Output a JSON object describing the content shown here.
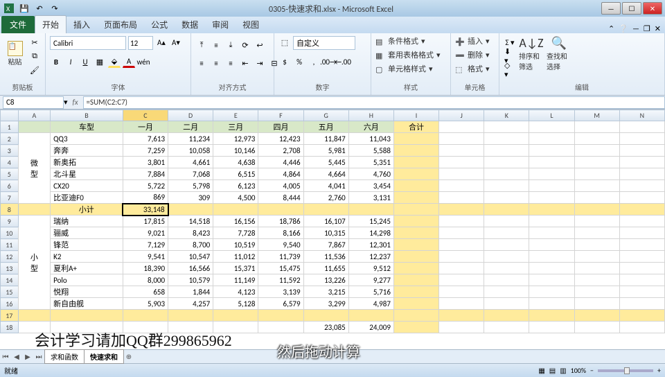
{
  "app": {
    "title": "0305-快速求和.xlsx - Microsoft Excel"
  },
  "tabs": {
    "file": "文件",
    "home": "开始",
    "insert": "插入",
    "layout": "页面布局",
    "formulas": "公式",
    "data": "数据",
    "review": "审阅",
    "view": "视图"
  },
  "ribbon": {
    "clipboard": {
      "label": "剪贴板",
      "paste": "粘贴"
    },
    "font": {
      "label": "字体",
      "name": "Calibri",
      "size": "12"
    },
    "alignment": {
      "label": "对齐方式"
    },
    "number": {
      "label": "数字",
      "format": "自定义"
    },
    "styles": {
      "label": "样式",
      "cond": "条件格式",
      "tablefmt": "套用表格格式",
      "cellfmt": "单元格样式"
    },
    "cells": {
      "label": "单元格",
      "insert": "插入",
      "delete": "删除",
      "format": "格式"
    },
    "editing": {
      "label": "编辑",
      "sortfilter": "排序和筛选",
      "findselect": "查找和选择"
    }
  },
  "nameBox": "C8",
  "formula": "=SUM(C2:C7)",
  "columns": [
    "A",
    "B",
    "C",
    "D",
    "E",
    "F",
    "G",
    "H",
    "I",
    "J",
    "K",
    "L",
    "M",
    "N"
  ],
  "header": {
    "model": "车型",
    "m1": "一月",
    "m2": "二月",
    "m3": "三月",
    "m4": "四月",
    "m5": "五月",
    "m6": "六月",
    "total": "合计"
  },
  "groupA": "微型",
  "groupB": "小型",
  "subtotal": "小计",
  "rows": [
    {
      "name": "QQ3",
      "v": [
        "7,613",
        "11,234",
        "12,973",
        "12,423",
        "11,847",
        "11,043"
      ]
    },
    {
      "name": "奔奔",
      "v": [
        "7,259",
        "10,058",
        "10,146",
        "2,708",
        "5,981",
        "5,588"
      ]
    },
    {
      "name": "新奥拓",
      "v": [
        "3,801",
        "4,661",
        "4,638",
        "4,446",
        "5,445",
        "5,351"
      ]
    },
    {
      "name": "北斗星",
      "v": [
        "7,884",
        "7,068",
        "6,515",
        "4,864",
        "4,664",
        "4,760"
      ]
    },
    {
      "name": "CX20",
      "v": [
        "5,722",
        "5,798",
        "6,123",
        "4,005",
        "4,041",
        "3,454"
      ]
    },
    {
      "name": "比亚迪F0",
      "v": [
        "869",
        "309",
        "4,500",
        "8,444",
        "2,760",
        "3,131"
      ]
    }
  ],
  "subtotalA": "33,148",
  "rowsB": [
    {
      "name": "瑞纳",
      "v": [
        "17,815",
        "14,518",
        "16,156",
        "18,786",
        "16,107",
        "15,245"
      ]
    },
    {
      "name": "骊威",
      "v": [
        "9,021",
        "8,423",
        "7,728",
        "8,166",
        "10,315",
        "14,298"
      ]
    },
    {
      "name": "锋范",
      "v": [
        "7,129",
        "8,700",
        "10,519",
        "9,540",
        "7,867",
        "12,301"
      ]
    },
    {
      "name": "K2",
      "v": [
        "9,541",
        "10,547",
        "11,012",
        "11,739",
        "11,536",
        "12,237"
      ]
    },
    {
      "name": "夏利A+",
      "v": [
        "18,390",
        "16,566",
        "15,371",
        "15,475",
        "11,655",
        "9,512"
      ]
    },
    {
      "name": "Polo",
      "v": [
        "8,000",
        "10,579",
        "11,149",
        "11,592",
        "13,226",
        "9,277"
      ]
    },
    {
      "name": "悦翔",
      "v": [
        "658",
        "1,844",
        "4,123",
        "3,139",
        "3,215",
        "5,716"
      ]
    },
    {
      "name": "新自由舰",
      "v": [
        "5,903",
        "4,257",
        "5,128",
        "6,579",
        "3,299",
        "4,987"
      ]
    }
  ],
  "row18": {
    "g": "23,085",
    "h": "24,009"
  },
  "sheetTabs": {
    "t1": "求和函数",
    "t2": "快速求和"
  },
  "status": {
    "ready": "就绪",
    "zoom": "100%"
  },
  "overlay1": "会计学习请加QQ群299865962",
  "overlay2": "然后拖动计算"
}
